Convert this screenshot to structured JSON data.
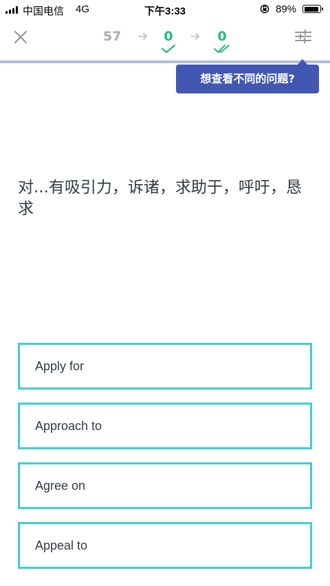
{
  "status_bar": {
    "carrier": "中国电信",
    "network": "4G",
    "time": "下午3:33",
    "battery_percent": "89%",
    "battery_level": 0.89
  },
  "nav": {
    "remaining_count": "57",
    "correct_count": "0",
    "mastered_count": "0",
    "icons": [
      "close-icon",
      "arrow-right-icon",
      "check-icon",
      "double-check-icon",
      "settings-sliders-icon"
    ],
    "accent_color": "#1fbf72"
  },
  "tooltip": {
    "text": "想查看不同的问题?",
    "color": "#4257b2"
  },
  "question": {
    "prompt": "对...有吸引力，诉诸，求助于，呼吁，恳求"
  },
  "options": [
    {
      "label": "Apply for"
    },
    {
      "label": "Approach to"
    },
    {
      "label": "Agree on"
    },
    {
      "label": "Appeal to"
    }
  ],
  "option_border_color": "#3ccfcf"
}
